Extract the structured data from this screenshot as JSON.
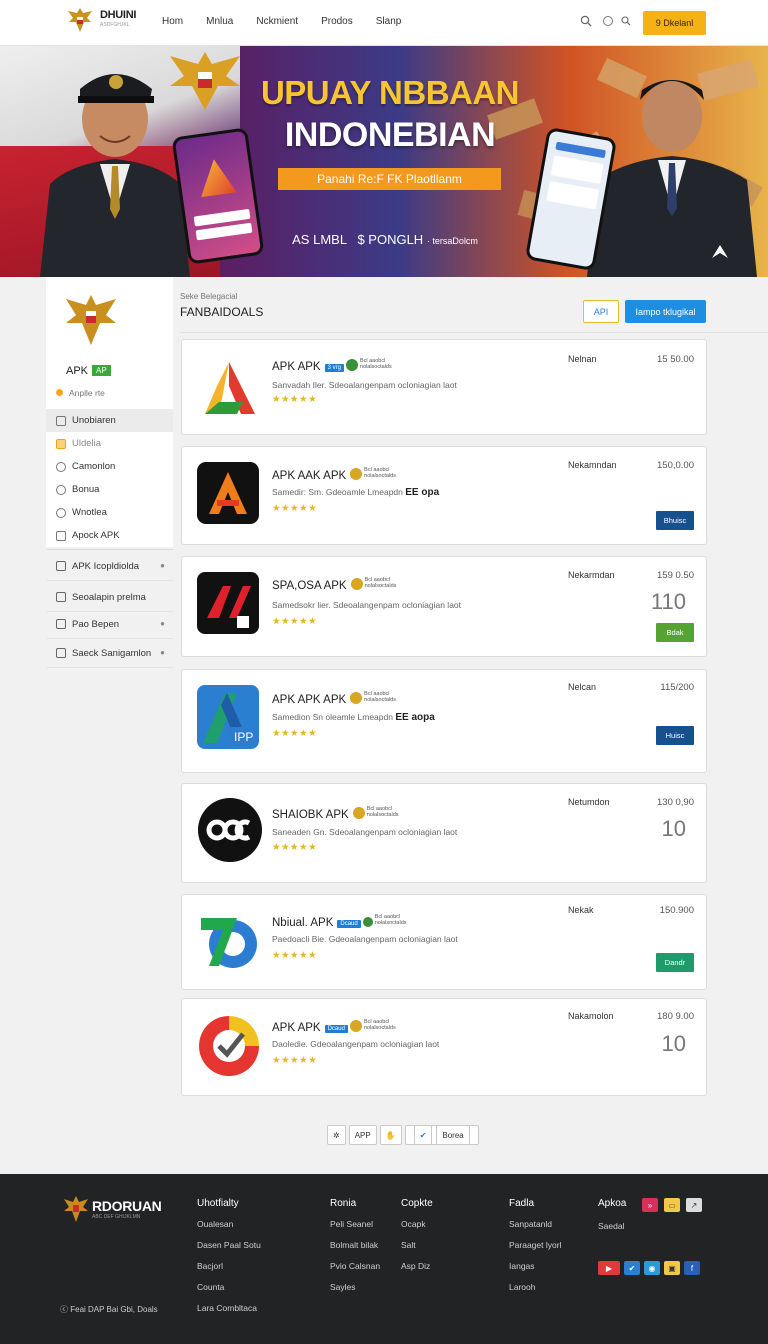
{
  "header": {
    "brand": "DHUINI",
    "brand_sub": "ASDFGHJKL",
    "nav": [
      "Hom",
      "Mnlua",
      "Nckmient",
      "Prodos",
      "Slanp"
    ],
    "cta": "9 Dkelanl"
  },
  "hero": {
    "title_line1": "UPUAY NBBAAN",
    "title_line2": "INDONEBIAN",
    "band": "Panahi Re:F FK Plaotllanm",
    "stats_a": "AS LMBL",
    "stats_b": "$ PONGLH",
    "stats_c": "· tersaDolcm"
  },
  "sidebar": {
    "apk_label": "APK",
    "apk_tag": "AP",
    "subtitle": "Anplle rte",
    "items": [
      "Unobiaren",
      "Uldelia",
      "Camonlon",
      "Bonua",
      "Wnotlea",
      "Apock APK"
    ],
    "groups": [
      "APK Icopldiolda",
      "Seoalapin prelma",
      "Pao Bepen",
      "Saeck Sanigamlon"
    ]
  },
  "main": {
    "eyebrow": "Seke Belegacial",
    "title": "FANBAIDOALS",
    "api_button": "API",
    "primary_button": "Iampo tklugikal"
  },
  "apps": [
    {
      "name": "APK APK",
      "desc": "Sanvadah Iler. Sdeoalangenpam ocloniagian laot",
      "bold": "",
      "stars": "★★★★★",
      "col": "Nelnan",
      "num": "15 50.00",
      "big": "",
      "action": ""
    },
    {
      "name": "APK AAK APK",
      "desc": "Samedir: Sm. Gdeoamle Lmeapdn",
      "bold": "EE opa",
      "stars": "★★★★★",
      "col": "Nekamndan",
      "num": "150,0.00",
      "big": "",
      "action": "Bhuisc"
    },
    {
      "name": "SPA,OSA APK",
      "desc": "Samedsokr lier. Sdeoalangenpam ocloniagian laot",
      "bold": "",
      "stars": "★★★★★",
      "col": "Nekarmdan",
      "num": "159 0.50",
      "big": "110",
      "action": "Bdak"
    },
    {
      "name": "APK APK APK",
      "desc": "Samedion Sn oleamle Lmeapdn",
      "bold": "EE aopa",
      "stars": "★★★★★",
      "col": "Nelcan",
      "num": "115/200",
      "big": "",
      "action": "Huisc"
    },
    {
      "name": "SHAIOBK APK",
      "desc": "Saneaden Gn. Sdeoalangenpam ocloniagian laot",
      "bold": "",
      "stars": "★★★★★",
      "col": "Netumdon",
      "num": "130 0,90",
      "big": "10",
      "action": ""
    },
    {
      "name": "Nbiual. APK",
      "desc": "Paedoacli Bie. Gdeoalangenpam ocloniagian laot",
      "bold": "",
      "stars": "★★★★★",
      "col": "Nekak",
      "num": "150.900",
      "big": "",
      "action": "Dandr"
    },
    {
      "name": "APK APK",
      "desc": "Daoledie. Gdeoalangenpam ocloniagian laot",
      "bold": "",
      "stars": "★★★★★",
      "col": "Nakamolon",
      "num": "180 9.00",
      "big": "10",
      "action": ""
    }
  ],
  "pager": {
    "app": "APP",
    "next": "Borea"
  },
  "footer": {
    "brand": "RDORUAN",
    "brand_sub": "ABC DEF GHIJKLMN",
    "copyright": "Feai DAP Bai Gbi, Doals",
    "columns": [
      {
        "title": "Uhotfialty",
        "links": [
          "Oualesan",
          "Dasen Paal Sotu",
          "Bacjorl",
          "Counta",
          "Lara Combltaca"
        ]
      },
      {
        "title": "Ronia",
        "links": [
          "Peli Seanel",
          "Bolmalt bilak",
          "Pvio Calsnan",
          "Sayles"
        ]
      },
      {
        "title": "Copkte",
        "links": [
          "Ocapk",
          "Salt",
          "Asp Diz"
        ]
      },
      {
        "title": "Fadla",
        "links": [
          "Sanpatanld",
          "Paraaget lyorl",
          "Iangas",
          "Larooh"
        ]
      },
      {
        "title": "Apkoa",
        "links": [
          "Saedal"
        ]
      }
    ]
  }
}
